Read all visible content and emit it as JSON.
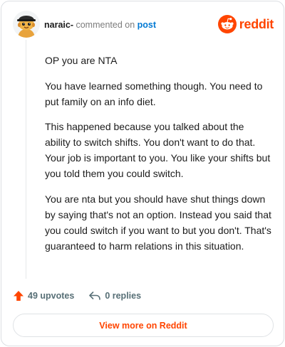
{
  "header": {
    "username": "naraic-",
    "action_text": " commented on ",
    "post_link": "post",
    "brand_name": "reddit"
  },
  "comment": {
    "paragraphs": [
      "OP you are NTA",
      "You have learned something though. You need to put family on an info diet.",
      "This happened because you talked about the ability to switch shifts. You don't want to do that. Your job is important to you. You like your shifts but you told them you could switch.",
      "You are nta but you should have shut things down by saying that's not an option. Instead you said that you could switch if you want to but you don't. That's guaranteed to harm relations in this situation."
    ]
  },
  "footer": {
    "upvotes_label": "49 upvotes",
    "replies_label": "0 replies"
  },
  "cta": {
    "label": "View more on Reddit"
  },
  "colors": {
    "brand": "#ff4500",
    "link": "#0079d3",
    "meta": "#576f76"
  }
}
